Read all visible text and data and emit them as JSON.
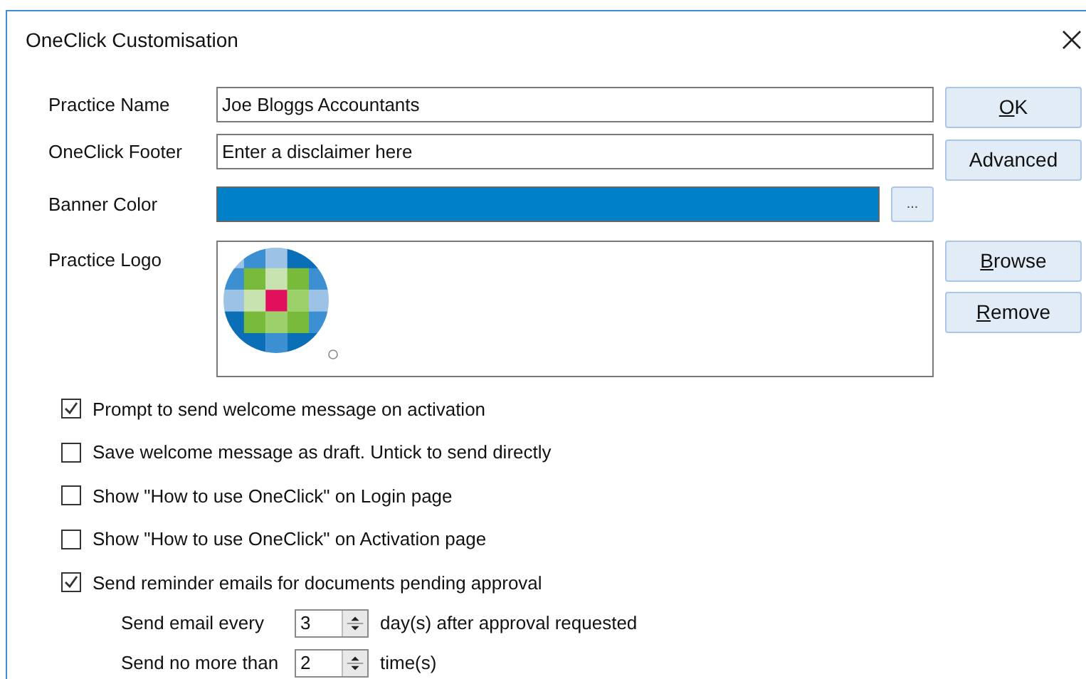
{
  "window": {
    "title": "OneClick Customisation"
  },
  "fields": [
    {
      "label": "Practice Name",
      "value": "Joe Bloggs Accountants"
    },
    {
      "label": "OneClick Footer",
      "value": "Enter a disclaimer here"
    }
  ],
  "banner": {
    "label": "Banner Color",
    "color": "#0080c6",
    "button": "..."
  },
  "logo": {
    "label": "Practice Logo"
  },
  "main_buttons": [
    {
      "label": "OK",
      "underline_first": true
    },
    {
      "label": "Advanced",
      "underline_first": false
    }
  ],
  "logo_buttons": [
    {
      "label": "Browse",
      "underline_first": true
    },
    {
      "label": "Remove",
      "underline_first": true
    }
  ],
  "options": [
    {
      "label": "Prompt to send welcome message on activation",
      "checked": true
    },
    {
      "label": "Save welcome message as draft. Untick to send directly",
      "checked": false
    },
    {
      "label": "Show \"How to use OneClick\" on Login page",
      "checked": false
    },
    {
      "label": "Show \"How to use OneClick\" on Activation page",
      "checked": false
    },
    {
      "label": "Send reminder emails for documents pending approval",
      "checked": true
    }
  ],
  "reminders": [
    {
      "label": "Send email every",
      "value": "3",
      "unit": "day(s) after approval requested"
    },
    {
      "label": "Send no more than",
      "value": "2",
      "unit": "time(s)"
    }
  ]
}
